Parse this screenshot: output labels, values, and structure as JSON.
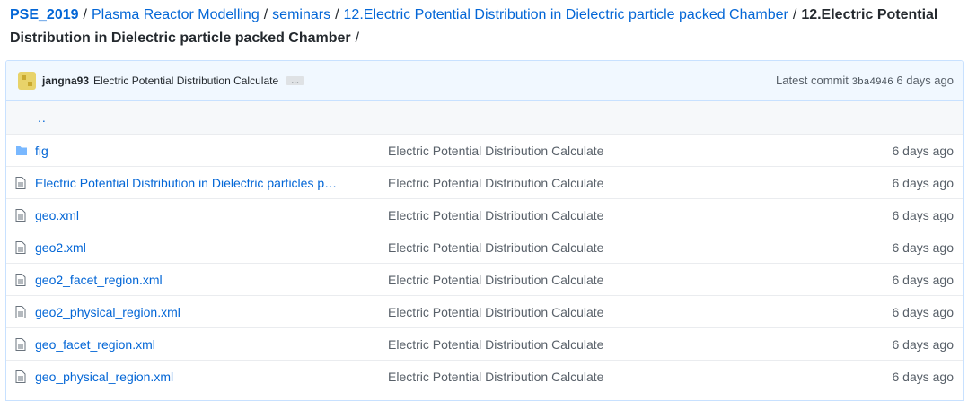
{
  "breadcrumb": {
    "repo": "PSE_2019",
    "items": [
      "Plasma Reactor Modelling",
      "seminars",
      "12.Electric Potential Distribution in Dielectric particle packed Chamber"
    ],
    "current": "12.Electric Potential Distribution in Dielectric particle packed Chamber",
    "trailing_sep": "/"
  },
  "commit": {
    "author": "jangna93",
    "message": "Electric Potential Distribution Calculate",
    "ellipsis": "…",
    "latest_label": "Latest commit",
    "sha": "3ba4946",
    "age": "6 days ago"
  },
  "parent_dir": "..",
  "files": [
    {
      "name": "fig",
      "type": "folder",
      "message": "Electric Potential Distribution Calculate",
      "age": "6 days ago"
    },
    {
      "name": "Electric Potential Distribution in Dielectric particles p…",
      "type": "file",
      "message": "Electric Potential Distribution Calculate",
      "age": "6 days ago"
    },
    {
      "name": "geo.xml",
      "type": "file",
      "message": "Electric Potential Distribution Calculate",
      "age": "6 days ago"
    },
    {
      "name": "geo2.xml",
      "type": "file",
      "message": "Electric Potential Distribution Calculate",
      "age": "6 days ago"
    },
    {
      "name": "geo2_facet_region.xml",
      "type": "file",
      "message": "Electric Potential Distribution Calculate",
      "age": "6 days ago"
    },
    {
      "name": "geo2_physical_region.xml",
      "type": "file",
      "message": "Electric Potential Distribution Calculate",
      "age": "6 days ago"
    },
    {
      "name": "geo_facet_region.xml",
      "type": "file",
      "message": "Electric Potential Distribution Calculate",
      "age": "6 days ago"
    },
    {
      "name": "geo_physical_region.xml",
      "type": "file",
      "message": "Electric Potential Distribution Calculate",
      "age": "6 days ago"
    }
  ],
  "colors": {
    "link": "#0366d6",
    "muted": "#586069",
    "folder": "#79b8ff",
    "file_icon": "#6a737d"
  },
  "icons": {
    "folder": "folder-icon",
    "file": "file-icon"
  }
}
